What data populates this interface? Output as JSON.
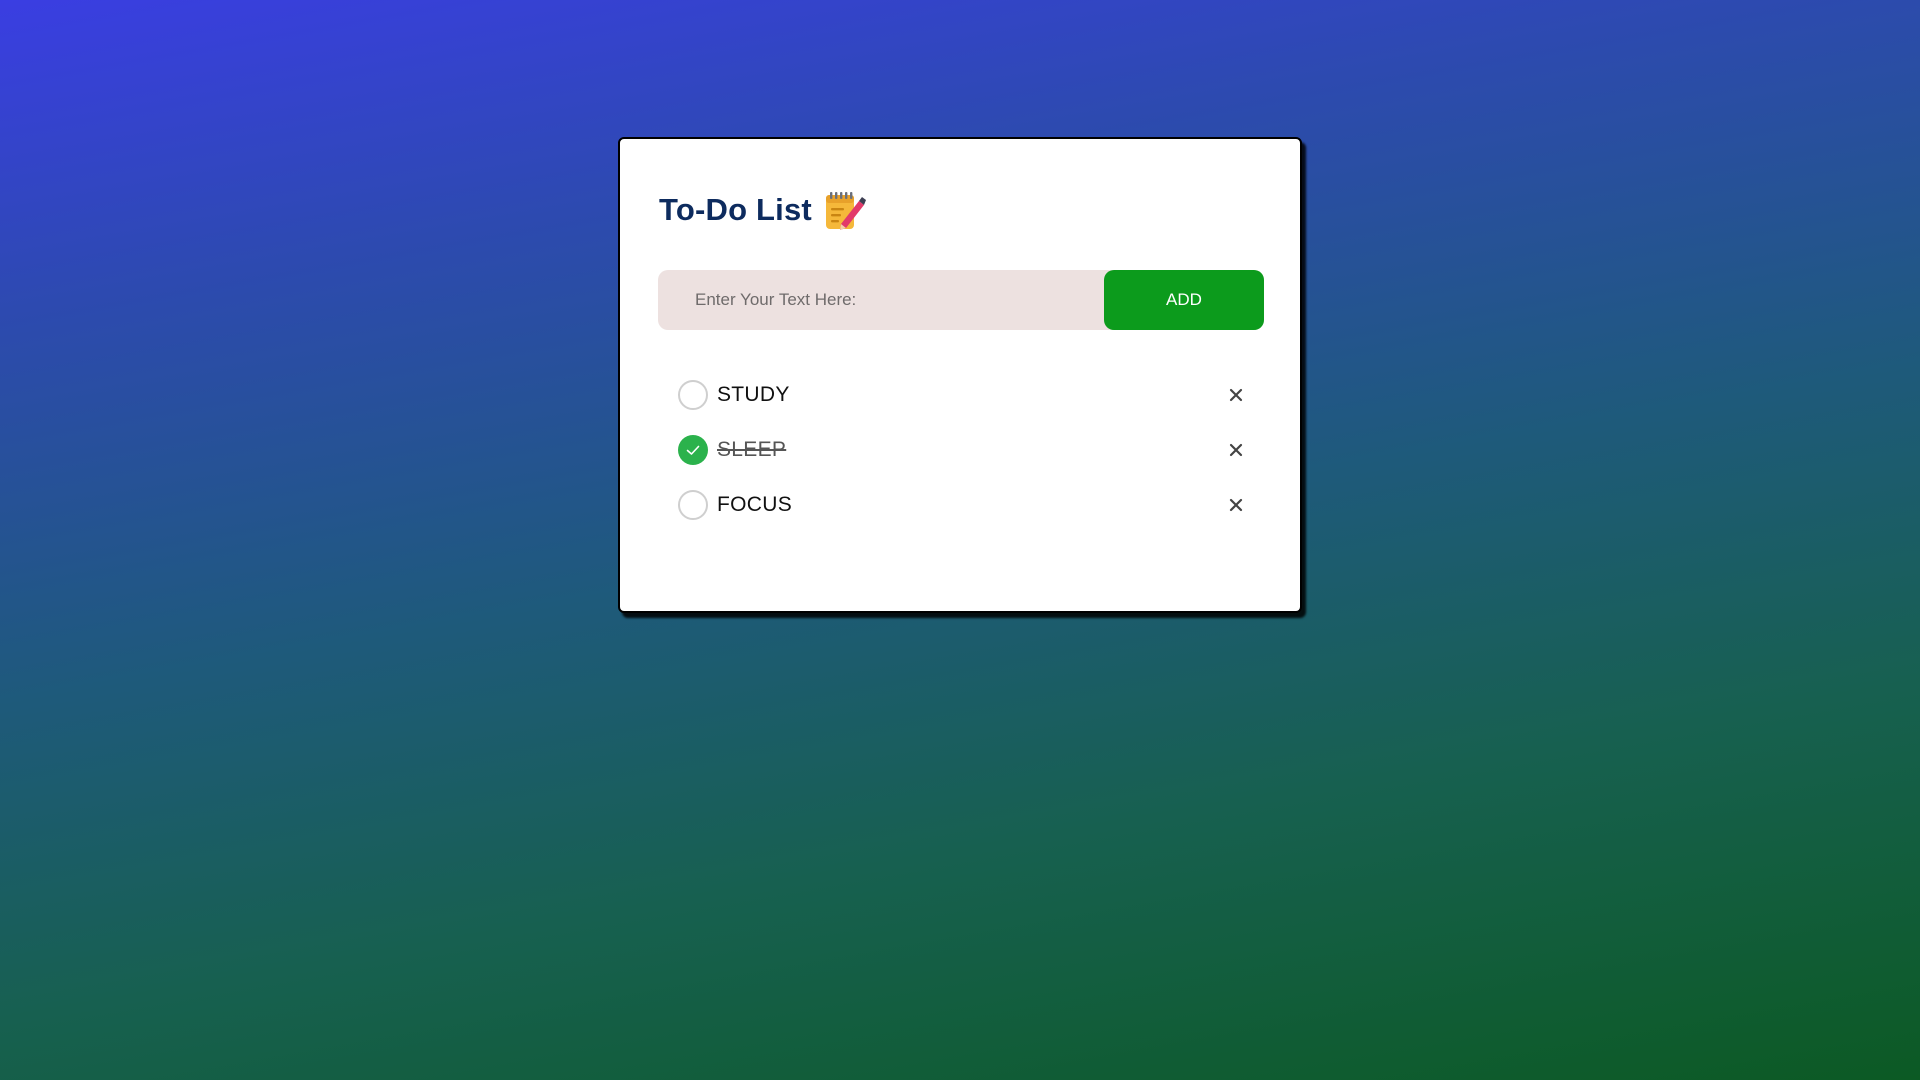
{
  "app": {
    "title": "To-Do List",
    "title_icon": "notepad-pencil-icon"
  },
  "input": {
    "placeholder": "Enter Your Text Here:",
    "value": ""
  },
  "add_button": {
    "label": "ADD",
    "color": "#0c9b1c"
  },
  "tasks": [
    {
      "label": "STUDY",
      "done": false,
      "remove_icon": "close-icon"
    },
    {
      "label": "SLEEP",
      "done": true,
      "remove_icon": "close-icon"
    },
    {
      "label": "FOCUS",
      "done": false,
      "remove_icon": "close-icon"
    }
  ],
  "colors": {
    "title": "#0d2b5e",
    "check_done": "#2bb24c",
    "input_bg": "#ede1e0",
    "background_top": "#3a3ee2",
    "background_bottom": "#0c5a24"
  }
}
